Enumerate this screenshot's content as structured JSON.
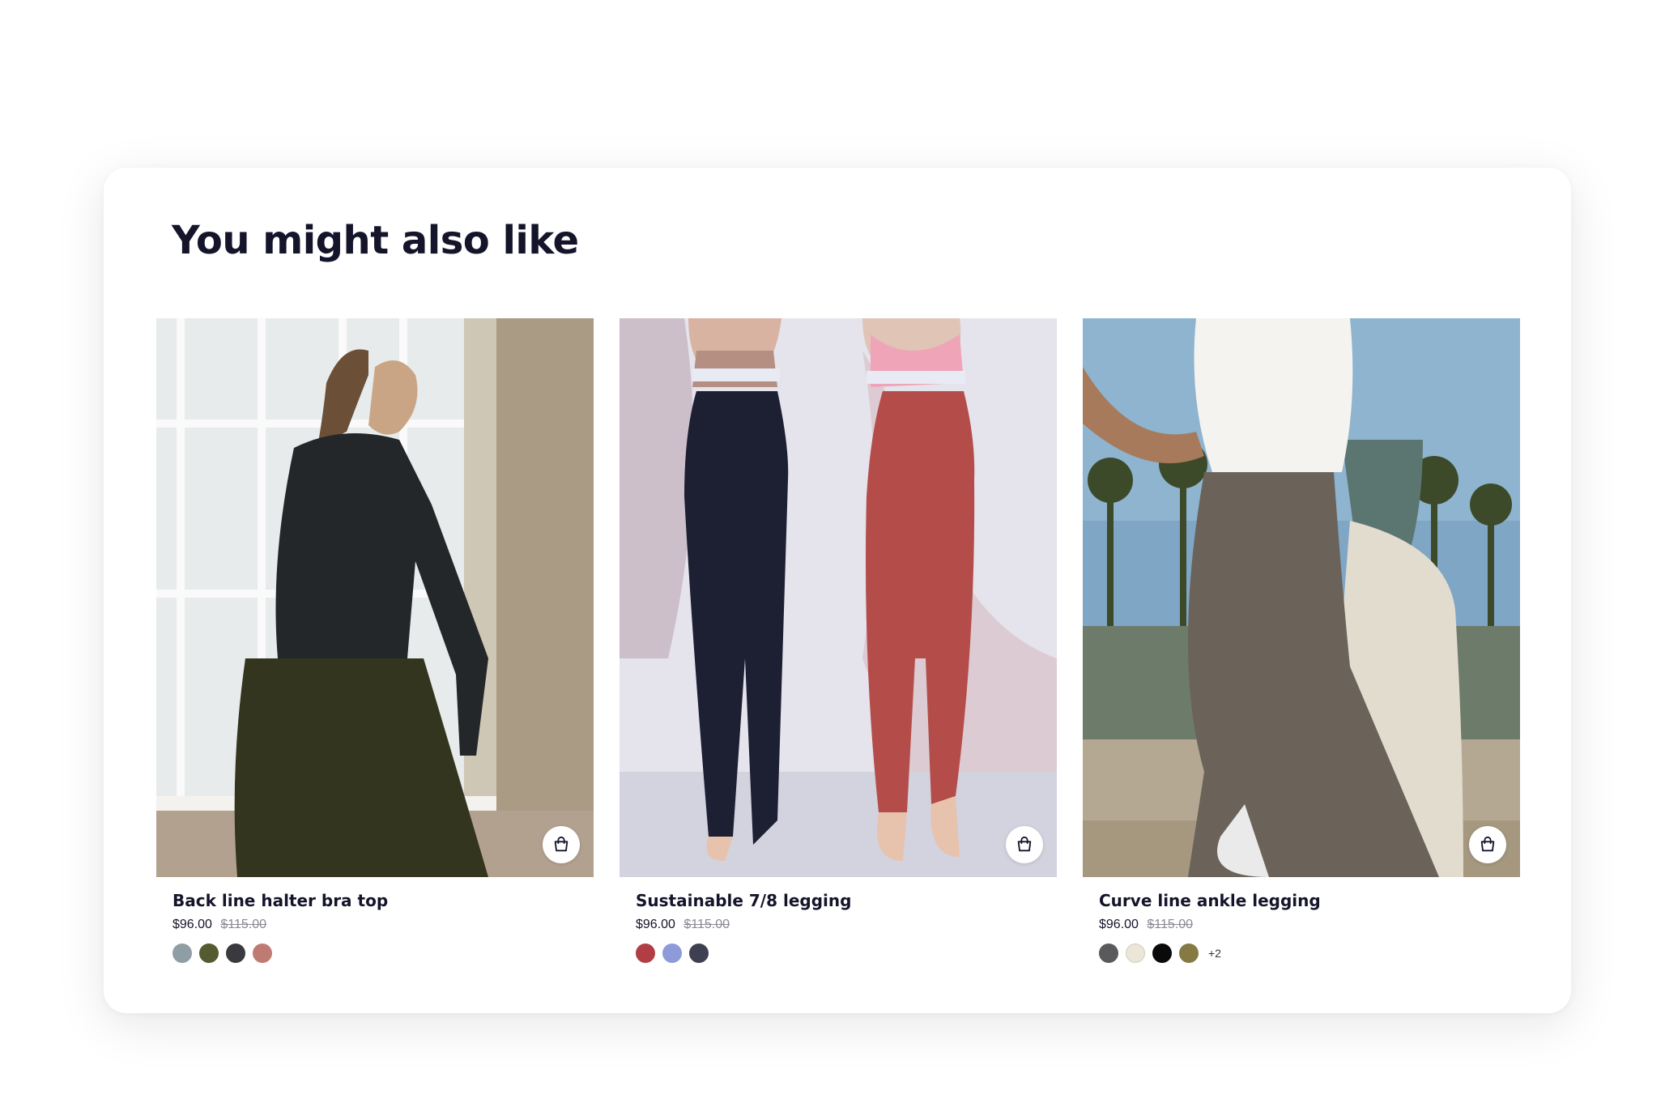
{
  "section": {
    "title": "You might also like"
  },
  "products": [
    {
      "name": "Back line halter bra top",
      "price": "$96.00",
      "old_price": "$115.00",
      "photo": "woman in black long-sleeve top and dark olive leggings by a window",
      "cart_icon": "shopping-bag-icon",
      "swatches": [
        "#8e9ea4",
        "#555a30",
        "#3a3a3e",
        "#c07a74"
      ],
      "more": ""
    },
    {
      "name": "Sustainable 7/8 legging",
      "price": "$96.00",
      "old_price": "$115.00",
      "photo": "two women in sports bras with navy and terracotta leggings",
      "cart_icon": "shopping-bag-icon",
      "swatches": [
        "#b23e45",
        "#8e9bd8",
        "#3f3f52"
      ],
      "more": ""
    },
    {
      "name": "Curve line ankle legging",
      "price": "$96.00",
      "old_price": "$115.00",
      "photo": "two women running outdoors in grey-brown and cream leggings",
      "cart_icon": "shopping-bag-icon",
      "swatches": [
        "#5a5a5c",
        "#ece6d8",
        "#0a0a0a",
        "#857a42"
      ],
      "more": "+2"
    }
  ]
}
